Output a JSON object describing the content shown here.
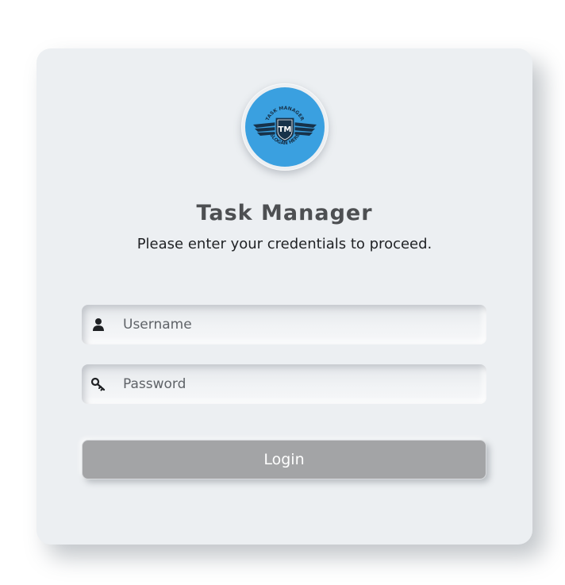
{
  "logo": {
    "alt": "Task Manager logo",
    "initials": "TM",
    "top_text": "TASK MANAGER",
    "bottom_text": "SLOGAN HERE",
    "background_color": "#3aa0e0",
    "icon": "shield-wings-icon"
  },
  "header": {
    "title": "Task Manager",
    "subtitle": "Please enter your credentials to proceed."
  },
  "form": {
    "username": {
      "placeholder": "Username",
      "value": "",
      "icon": "user-icon"
    },
    "password": {
      "placeholder": "Password",
      "value": "",
      "icon": "key-icon"
    },
    "login_label": "Login"
  },
  "colors": {
    "card_background": "#eceff2",
    "button_background": "#a3a4a6",
    "title_color": "#4d4f52"
  }
}
